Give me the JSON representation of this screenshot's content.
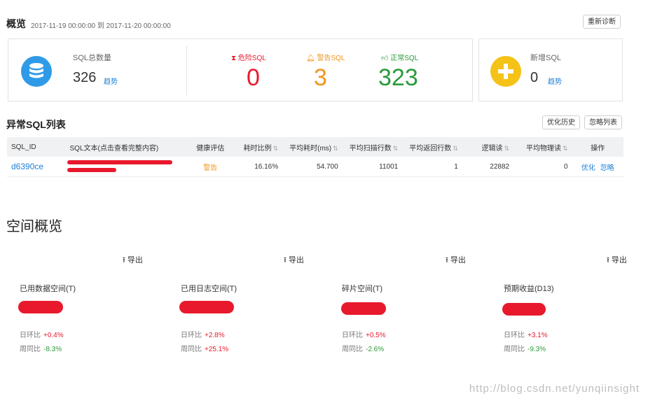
{
  "header": {
    "title": "概览",
    "range": "2017-11-19 00:00:00 到 2017-11-20 00:00:00",
    "rediagnose_label": "重新诊断"
  },
  "overview": {
    "total": {
      "label": "SQL总数量",
      "value": "326",
      "trend_label": "趋势"
    },
    "danger": {
      "label": "危险SQL",
      "value": "0",
      "color": "#e8192c"
    },
    "warning": {
      "label": "警告SQL",
      "value": "3",
      "color": "#f0961e"
    },
    "normal": {
      "label": "正常SQL",
      "value": "323",
      "color": "#2b9a3a"
    },
    "new_sql": {
      "label": "新增SQL",
      "value": "0",
      "trend_label": "趋势"
    }
  },
  "abnormal": {
    "title": "异常SQL列表",
    "history_label": "优化历史",
    "ignore_list_label": "忽略列表",
    "columns": [
      "SQL_ID",
      "SQL文本(点击查看完整内容)",
      "健康评估",
      "耗时比例",
      "平均耗时(ms)",
      "平均扫描行数",
      "平均返回行数",
      "逻辑读",
      "平均物理读",
      "操作"
    ],
    "rows": [
      {
        "sql_id": "d6390ce",
        "health": "警告",
        "time_ratio": "16.16%",
        "avg_time": "54.700",
        "avg_scan": "11001",
        "avg_return": "1",
        "logical_read": "22882",
        "avg_physical": "0",
        "action_optimize": "优化",
        "action_ignore": "忽略"
      }
    ]
  },
  "space": {
    "title": "空间概览",
    "export_label": "导出",
    "day_label": "日环比",
    "week_label": "周同比",
    "metrics": [
      {
        "label": "已用数据空间(T)",
        "day": "+0.4%",
        "week": "-8.3%"
      },
      {
        "label": "已用日志空间(T)",
        "day": "+2.8%",
        "week": "+25.1%"
      },
      {
        "label": "碎片空间(T)",
        "day": "+0.5%",
        "week": "-2.6%"
      },
      {
        "label": "预期收益(D13)",
        "day": "+3.1%",
        "week": "-9.3%"
      }
    ]
  },
  "colors": {
    "accent": "#1e7fd6",
    "danger": "#e8192c",
    "warning": "#f0961e",
    "normal": "#2b9a3a",
    "db_icon": "#2f9be8",
    "plus_icon": "#f5c218"
  },
  "watermark": "http://blog.csdn.net/yunqiinsight"
}
